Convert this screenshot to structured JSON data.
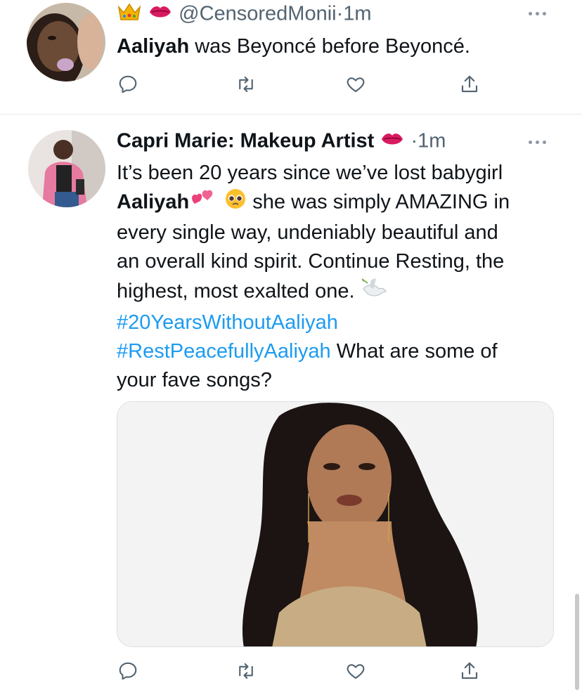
{
  "tweet1": {
    "handle": "@CensoredMonii",
    "dot": "·",
    "time": "1m",
    "emojis": [
      "crown-emoji",
      "kiss-emoji"
    ],
    "text_bold": "Aaliyah",
    "text_rest": " was Beyoncé before Beyoncé."
  },
  "tweet2": {
    "name": "Capri Marie: Makeup Artist",
    "dot": "·",
    "time": "1m",
    "line1": "It’s been 20 years since we’ve lost babygirl",
    "bold_name": "Aaliyah",
    "line2_rest": " she was simply AMAZING in",
    "line3": "every single way, undeniably beautiful and",
    "line4": "an overall kind spirit. Continue Resting, the",
    "line5": "highest, most exalted one.",
    "hashtag1": "#20YearsWithoutAaliyah",
    "hashtag2": "#RestPeacefullyAaliyah",
    "line7_rest": " What are some of",
    "line8": "your fave songs?"
  },
  "colors": {
    "text": "#0f1419",
    "muted": "#536471",
    "link": "#1d9bf0",
    "divider": "#e6ecf0"
  }
}
